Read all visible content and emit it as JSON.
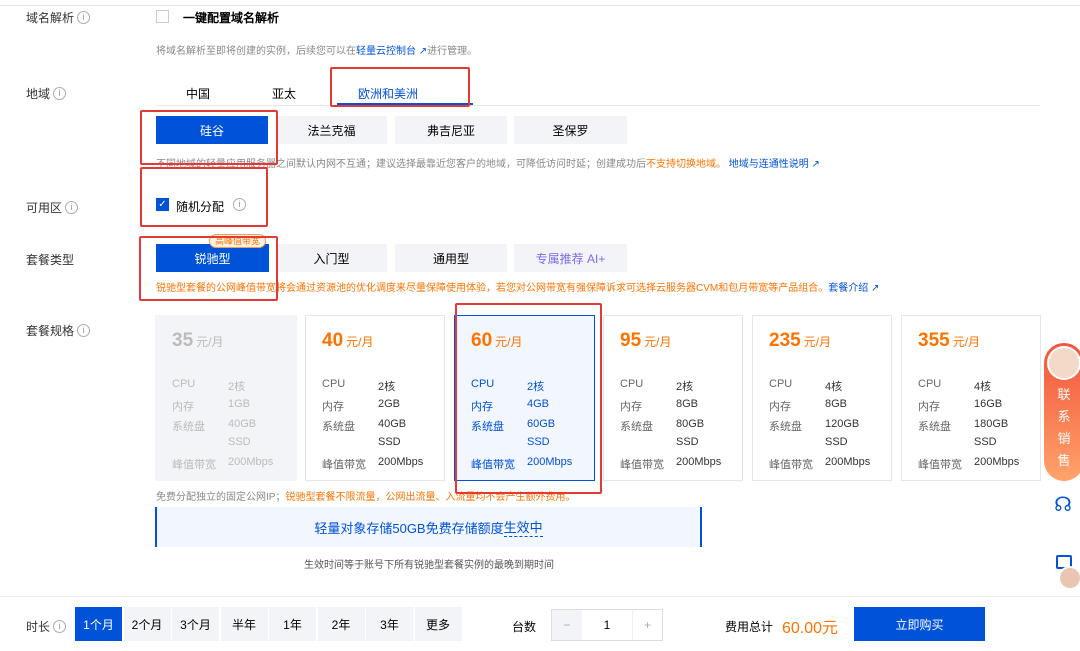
{
  "domain_dns": {
    "label": "域名解析",
    "checkbox_label": "一键配置域名解析",
    "hint_pre": "将域名解析至即将创建的实例，后续您可以在",
    "hint_link": "轻量云控制台",
    "hint_post": "进行管理。"
  },
  "region": {
    "label": "地域",
    "tabs": [
      "中国",
      "亚太",
      "欧洲和美洲"
    ],
    "active_tab": 2,
    "cities": [
      "硅谷",
      "法兰克福",
      "弗吉尼亚",
      "圣保罗"
    ],
    "active_city": 0,
    "hint_pre": "不同地域的轻量应用服务器之间默认内网不互通；建议选择最靠近您客户的地域，可降低访问时延；创建成功后",
    "hint_warn": "不支持切换地域。",
    "hint_link": "地域与连通性说明"
  },
  "zone": {
    "label": "可用区",
    "checkbox_label": "随机分配",
    "checked": true
  },
  "plan_type": {
    "label": "套餐类型",
    "options": [
      "锐驰型",
      "入门型",
      "通用型",
      "专属推荐 AI+"
    ],
    "active": 0,
    "badge": "高峰值带宽",
    "hint": "锐驰型套餐的公网峰值带宽将会通过资源池的优化调度来尽量保障使用体验，若您对公网带宽有强保障诉求可选择云服务器CVM和包月带宽等产品组合。",
    "hint_link": "套餐介绍"
  },
  "plan_spec": {
    "label": "套餐规格",
    "unit": "元/月",
    "keys": [
      "CPU",
      "内存",
      "系统盘",
      "峰值带宽"
    ],
    "cards": [
      {
        "price": "35",
        "cpu": "2核",
        "mem": "1GB",
        "disk": "40GB",
        "disk2": "SSD",
        "bw": "200Mbps",
        "state": "disabled"
      },
      {
        "price": "40",
        "cpu": "2核",
        "mem": "2GB",
        "disk": "40GB",
        "disk2": "SSD",
        "bw": "200Mbps",
        "state": "normal"
      },
      {
        "price": "60",
        "cpu": "2核",
        "mem": "4GB",
        "disk": "60GB",
        "disk2": "SSD",
        "bw": "200Mbps",
        "state": "selected"
      },
      {
        "price": "95",
        "cpu": "2核",
        "mem": "8GB",
        "disk": "80GB",
        "disk2": "SSD",
        "bw": "200Mbps",
        "state": "normal"
      },
      {
        "price": "235",
        "cpu": "4核",
        "mem": "8GB",
        "disk": "120GB",
        "disk2": "SSD",
        "bw": "200Mbps",
        "state": "normal"
      },
      {
        "price": "355",
        "cpu": "4核",
        "mem": "16GB",
        "disk": "180GB",
        "disk2": "SSD",
        "bw": "200Mbps",
        "state": "normal"
      }
    ],
    "note_pre": "免费分配独立的固定公网IP；",
    "note_warn": "锐驰型套餐不限流量，公网出流量、入流量均不会产生额外费用。",
    "banner_pre": "轻量对象存储50GB免费存储额度",
    "banner_link": "生效中",
    "banner_sub": "生效时间等于账号下所有锐驰型套餐实例的最晚到期时间"
  },
  "side": {
    "contact": "联系销售"
  },
  "footer": {
    "duration_label": "时长",
    "durations": [
      "1个月",
      "2个月",
      "3个月",
      "半年",
      "1年",
      "2年",
      "3年",
      "更多"
    ],
    "active": 0,
    "qty_label": "台数",
    "qty": "1",
    "minus": "−",
    "plus": "+",
    "total_label": "费用总计",
    "total": "60.00元",
    "buy": "立即购买"
  }
}
